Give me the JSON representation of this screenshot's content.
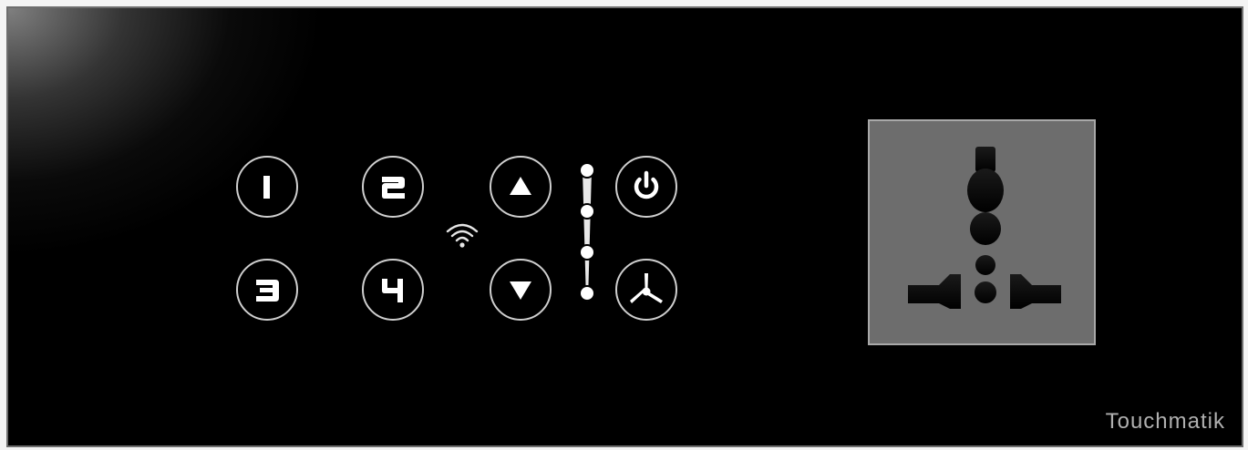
{
  "panel": {
    "brand": "Touchmatik",
    "switches": [
      {
        "label": "1"
      },
      {
        "label": "2"
      },
      {
        "label": "3"
      },
      {
        "label": "4"
      }
    ],
    "fan": {
      "up_icon": "triangle-up-icon",
      "down_icon": "triangle-down-icon",
      "power_icon": "power-icon",
      "fan_icon": "fan-icon",
      "speed_levels": 4
    },
    "wifi_icon": "wifi-icon",
    "socket": "universal-socket"
  }
}
